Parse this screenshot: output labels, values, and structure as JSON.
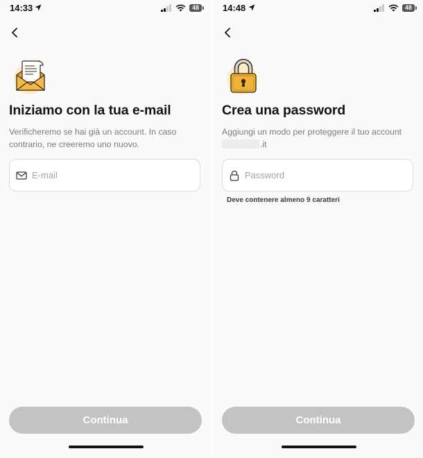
{
  "screens": [
    {
      "status_bar": {
        "time": "14:33",
        "battery": "48"
      },
      "title": "Iniziamo con la tua e-mail",
      "subtitle": "Verificheremo se hai già un account. In caso contrario, ne creeremo uno nuovo.",
      "input": {
        "placeholder": "E-mail",
        "value": "",
        "icon": "mail-icon"
      },
      "continue_label": "Continua",
      "hero_icon": "envelope-letter-icon"
    },
    {
      "status_bar": {
        "time": "14:48",
        "battery": "48"
      },
      "title": "Crea una password",
      "subtitle": "Aggiungi un modo per proteggere il tuo account",
      "masked_email_suffix": ".it",
      "input": {
        "placeholder": "Password",
        "value": "",
        "icon": "lock-icon"
      },
      "hint": "Deve contenere almeno 9 caratteri",
      "continue_label": "Continua",
      "hero_icon": "padlock-icon"
    }
  ],
  "colors": {
    "button_disabled": "#c3c3c3",
    "icon_accent": "#f0b23a",
    "icon_badge": "#fdecc8"
  }
}
